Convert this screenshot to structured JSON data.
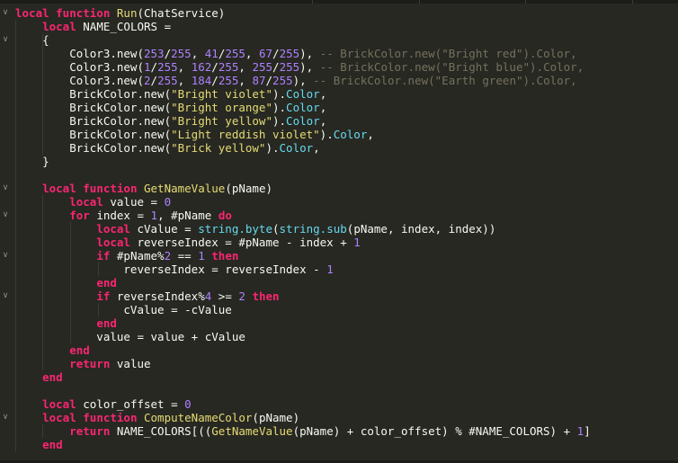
{
  "editor": {
    "language": "Lua",
    "theme_colors": {
      "background": "#272822",
      "keyword": "#f92672",
      "function_name": "#e6db74",
      "number": "#ae81ff",
      "string": "#e6db74",
      "comment": "#75715e",
      "builtin": "#66d9ef",
      "plain": "#f8f8f2"
    },
    "fold_icon": "chevron-down-icon",
    "lines": [
      [
        [
          "kw",
          "local function "
        ],
        [
          "fn",
          "Run"
        ],
        [
          "pl",
          "(ChatService)"
        ]
      ],
      [
        [
          "pl",
          "    "
        ],
        [
          "kw",
          "local "
        ],
        [
          "pl",
          "NAME_COLORS = "
        ]
      ],
      [
        [
          "pl",
          "    {"
        ]
      ],
      [
        [
          "pl",
          "        Color3.new("
        ],
        [
          "num",
          "253"
        ],
        [
          "pl",
          "/"
        ],
        [
          "num",
          "255"
        ],
        [
          "pl",
          ", "
        ],
        [
          "num",
          "41"
        ],
        [
          "pl",
          "/"
        ],
        [
          "num",
          "255"
        ],
        [
          "pl",
          ", "
        ],
        [
          "num",
          "67"
        ],
        [
          "pl",
          "/"
        ],
        [
          "num",
          "255"
        ],
        [
          "pl",
          "), "
        ],
        [
          "cm",
          "-- BrickColor.new(\"Bright red\").Color,"
        ]
      ],
      [
        [
          "pl",
          "        Color3.new("
        ],
        [
          "num",
          "1"
        ],
        [
          "pl",
          "/"
        ],
        [
          "num",
          "255"
        ],
        [
          "pl",
          ", "
        ],
        [
          "num",
          "162"
        ],
        [
          "pl",
          "/"
        ],
        [
          "num",
          "255"
        ],
        [
          "pl",
          ", "
        ],
        [
          "num",
          "255"
        ],
        [
          "pl",
          "/"
        ],
        [
          "num",
          "255"
        ],
        [
          "pl",
          "), "
        ],
        [
          "cm",
          "-- BrickColor.new(\"Bright blue\").Color,"
        ]
      ],
      [
        [
          "pl",
          "        Color3.new("
        ],
        [
          "num",
          "2"
        ],
        [
          "pl",
          "/"
        ],
        [
          "num",
          "255"
        ],
        [
          "pl",
          ", "
        ],
        [
          "num",
          "184"
        ],
        [
          "pl",
          "/"
        ],
        [
          "num",
          "255"
        ],
        [
          "pl",
          ", "
        ],
        [
          "num",
          "87"
        ],
        [
          "pl",
          "/"
        ],
        [
          "num",
          "255"
        ],
        [
          "pl",
          "), "
        ],
        [
          "cm",
          "-- BrickColor.new(\"Earth green\").Color,"
        ]
      ],
      [
        [
          "pl",
          "        BrickColor.new("
        ],
        [
          "str",
          "\"Bright violet\""
        ],
        [
          "pl",
          ")."
        ],
        [
          "lib",
          "Color"
        ],
        [
          "pl",
          ","
        ]
      ],
      [
        [
          "pl",
          "        BrickColor.new("
        ],
        [
          "str",
          "\"Bright orange\""
        ],
        [
          "pl",
          ")."
        ],
        [
          "lib",
          "Color"
        ],
        [
          "pl",
          ","
        ]
      ],
      [
        [
          "pl",
          "        BrickColor.new("
        ],
        [
          "str",
          "\"Bright yellow\""
        ],
        [
          "pl",
          ")."
        ],
        [
          "lib",
          "Color"
        ],
        [
          "pl",
          ","
        ]
      ],
      [
        [
          "pl",
          "        BrickColor.new("
        ],
        [
          "str",
          "\"Light reddish violet\""
        ],
        [
          "pl",
          ")."
        ],
        [
          "lib",
          "Color"
        ],
        [
          "pl",
          ","
        ]
      ],
      [
        [
          "pl",
          "        BrickColor.new("
        ],
        [
          "str",
          "\"Brick yellow\""
        ],
        [
          "pl",
          ")."
        ],
        [
          "lib",
          "Color"
        ],
        [
          "pl",
          ","
        ]
      ],
      [
        [
          "pl",
          "    }"
        ]
      ],
      [
        [
          "pl",
          ""
        ]
      ],
      [
        [
          "pl",
          "    "
        ],
        [
          "kw",
          "local function "
        ],
        [
          "fn",
          "GetNameValue"
        ],
        [
          "pl",
          "(pName)"
        ]
      ],
      [
        [
          "pl",
          "        "
        ],
        [
          "kw",
          "local "
        ],
        [
          "pl",
          "value = "
        ],
        [
          "num",
          "0"
        ]
      ],
      [
        [
          "pl",
          "        "
        ],
        [
          "kw",
          "for "
        ],
        [
          "pl",
          "index = "
        ],
        [
          "num",
          "1"
        ],
        [
          "pl",
          ", #pName "
        ],
        [
          "kw",
          "do"
        ]
      ],
      [
        [
          "pl",
          "            "
        ],
        [
          "kw",
          "local "
        ],
        [
          "pl",
          "cValue = "
        ],
        [
          "lib",
          "string.byte"
        ],
        [
          "pl",
          "("
        ],
        [
          "lib",
          "string.sub"
        ],
        [
          "pl",
          "(pName, index, index))"
        ]
      ],
      [
        [
          "pl",
          "            "
        ],
        [
          "kw",
          "local "
        ],
        [
          "pl",
          "reverseIndex = #pName - index + "
        ],
        [
          "num",
          "1"
        ]
      ],
      [
        [
          "pl",
          "            "
        ],
        [
          "kw",
          "if "
        ],
        [
          "pl",
          "#pName%"
        ],
        [
          "num",
          "2"
        ],
        [
          "pl",
          " == "
        ],
        [
          "num",
          "1"
        ],
        [
          "pl",
          " "
        ],
        [
          "kw",
          "then"
        ]
      ],
      [
        [
          "pl",
          "                reverseIndex = reverseIndex - "
        ],
        [
          "num",
          "1"
        ]
      ],
      [
        [
          "pl",
          "            "
        ],
        [
          "kw",
          "end"
        ]
      ],
      [
        [
          "pl",
          "            "
        ],
        [
          "kw",
          "if "
        ],
        [
          "pl",
          "reverseIndex%"
        ],
        [
          "num",
          "4"
        ],
        [
          "pl",
          " >= "
        ],
        [
          "num",
          "2"
        ],
        [
          "pl",
          " "
        ],
        [
          "kw",
          "then"
        ]
      ],
      [
        [
          "pl",
          "                cValue = -cValue"
        ]
      ],
      [
        [
          "pl",
          "            "
        ],
        [
          "kw",
          "end"
        ]
      ],
      [
        [
          "pl",
          "            value = value + cValue"
        ]
      ],
      [
        [
          "pl",
          "        "
        ],
        [
          "kw",
          "end"
        ]
      ],
      [
        [
          "pl",
          "        "
        ],
        [
          "kw",
          "return "
        ],
        [
          "pl",
          "value"
        ]
      ],
      [
        [
          "pl",
          "    "
        ],
        [
          "kw",
          "end"
        ]
      ],
      [
        [
          "pl",
          ""
        ]
      ],
      [
        [
          "pl",
          "    "
        ],
        [
          "kw",
          "local "
        ],
        [
          "pl",
          "color_offset = "
        ],
        [
          "num",
          "0"
        ]
      ],
      [
        [
          "pl",
          "    "
        ],
        [
          "kw",
          "local function "
        ],
        [
          "fn",
          "ComputeNameColor"
        ],
        [
          "pl",
          "(pName)"
        ]
      ],
      [
        [
          "pl",
          "        "
        ],
        [
          "kw",
          "return "
        ],
        [
          "pl",
          "NAME_COLORS[(("
        ],
        [
          "fn",
          "GetNameValue"
        ],
        [
          "pl",
          "(pName) + color_offset) % #NAME_COLORS) + "
        ],
        [
          "num",
          "1"
        ],
        [
          "pl",
          "]"
        ]
      ],
      [
        [
          "pl",
          "    "
        ],
        [
          "kw",
          "end"
        ]
      ]
    ],
    "fold_lines": [
      0,
      2,
      13,
      15,
      18,
      21,
      30
    ]
  }
}
